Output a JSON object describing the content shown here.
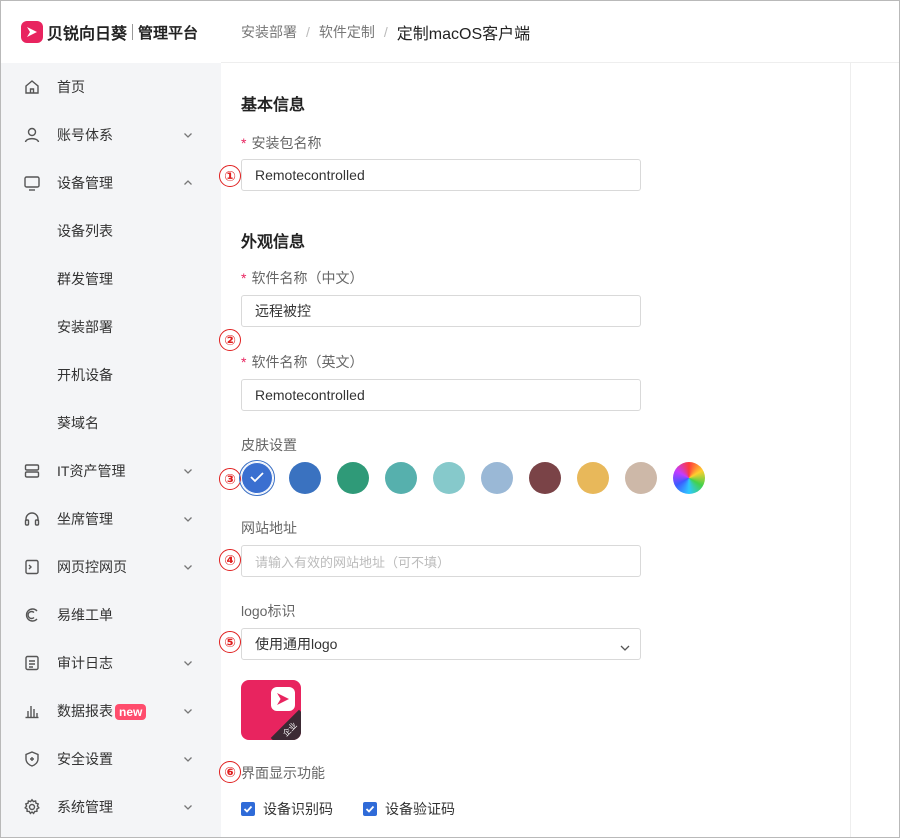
{
  "brand": {
    "name": "贝锐向日葵",
    "sub": "管理平台"
  },
  "sidebar": {
    "items": [
      {
        "label": "首页",
        "icon": "home-icon",
        "chevron": ""
      },
      {
        "label": "账号体系",
        "icon": "user-icon",
        "chevron": "down"
      },
      {
        "label": "设备管理",
        "icon": "monitor-icon",
        "chevron": "up"
      },
      {
        "label": "IT资产管理",
        "icon": "server-icon",
        "chevron": "down"
      },
      {
        "label": "坐席管理",
        "icon": "headset-icon",
        "chevron": "down"
      },
      {
        "label": "网页控网页",
        "icon": "terminal-icon",
        "chevron": "down"
      },
      {
        "label": "易维工单",
        "icon": "ticket-icon",
        "chevron": ""
      },
      {
        "label": "审计日志",
        "icon": "log-icon",
        "chevron": "down"
      },
      {
        "label": "数据报表",
        "icon": "chart-icon",
        "chevron": "down",
        "badge": "new"
      },
      {
        "label": "安全设置",
        "icon": "shield-icon",
        "chevron": "down"
      },
      {
        "label": "系统管理",
        "icon": "gear-icon",
        "chevron": "down"
      }
    ],
    "device_sub": [
      "设备列表",
      "群发管理",
      "安装部署",
      "开机设备",
      "葵域名"
    ]
  },
  "breadcrumb": {
    "level1": "安装部署",
    "level2": "软件定制",
    "current": "定制macOS客户端",
    "separator": "/"
  },
  "form": {
    "basic_title": "基本信息",
    "package_label": "安装包名称",
    "package_value": "Remotecontrolled",
    "appearance_title": "外观信息",
    "name_cn_label": "软件名称（中文）",
    "name_cn_value": "远程被控",
    "name_en_label": "软件名称（英文）",
    "name_en_value": "Remotecontrolled",
    "skin_label": "皮肤设置",
    "skin_colors": [
      "#3a6fd0",
      "#3a72c0",
      "#2f9a78",
      "#56b0ad",
      "#86c9cb",
      "#9ab8d6",
      "#7a4347",
      "#e8b85a",
      "#cdb8a8",
      "rainbow"
    ],
    "skin_selected": 0,
    "website_label": "网站地址",
    "website_placeholder": "请输入有效的网站地址（可不填）",
    "logo_label": "logo标识",
    "logo_value": "使用通用logo",
    "logo_corner_text": "企业",
    "display_label": "界面显示功能",
    "display_options": [
      "设备识别码",
      "设备验证码"
    ]
  },
  "markers": [
    "①",
    "②",
    "③",
    "④",
    "⑤",
    "⑥"
  ],
  "colors": {
    "brand": "#e8245f",
    "accent": "#2f6bd8",
    "marker": "#e02020",
    "required": "#e8245f"
  }
}
